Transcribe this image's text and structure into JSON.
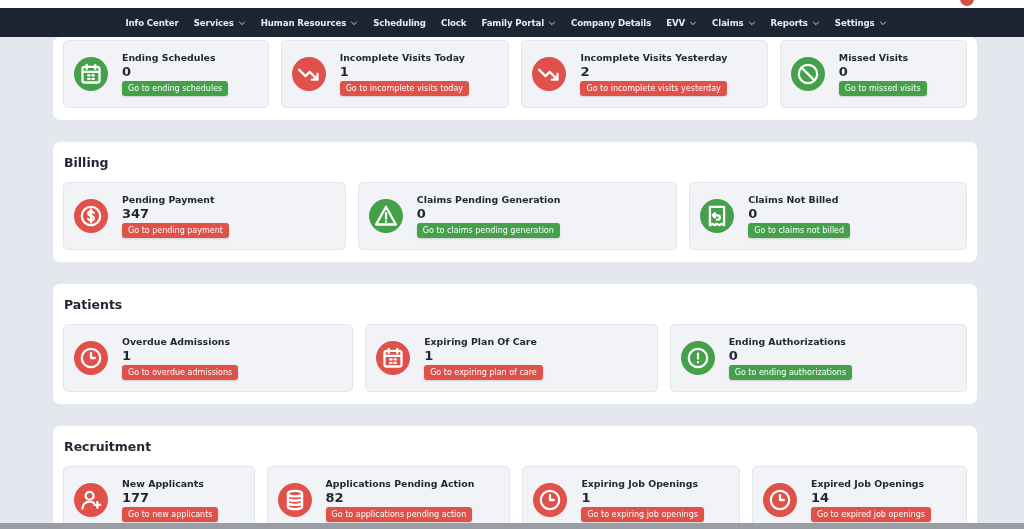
{
  "nav": {
    "items": [
      {
        "label": "Info Center",
        "has_menu": false
      },
      {
        "label": "Services",
        "has_menu": true
      },
      {
        "label": "Human Resources",
        "has_menu": true
      },
      {
        "label": "Scheduling",
        "has_menu": false
      },
      {
        "label": "Clock",
        "has_menu": false
      },
      {
        "label": "Family Portal",
        "has_menu": true
      },
      {
        "label": "Company Details",
        "has_menu": false
      },
      {
        "label": "EVV",
        "has_menu": true
      },
      {
        "label": "Claims",
        "has_menu": true
      },
      {
        "label": "Reports",
        "has_menu": true
      },
      {
        "label": "Settings",
        "has_menu": true
      }
    ]
  },
  "sections": [
    {
      "cards": [
        {
          "title": "Ending Schedules",
          "count": "0",
          "link": "Go to ending schedules",
          "color": "#44a14a"
        },
        {
          "title": "Incomplete Visits Today",
          "count": "1",
          "link": "Go to incomplete visits today",
          "color": "#e0514a"
        },
        {
          "title": "Incomplete Visits Yesterday",
          "count": "2",
          "link": "Go to incomplete visits yesterday",
          "color": "#e0514a"
        },
        {
          "title": "Missed Visits",
          "count": "0",
          "link": "Go to missed visits",
          "color": "#44a14a"
        }
      ]
    },
    {
      "title": "Billing",
      "cards": [
        {
          "title": "Pending Payment",
          "count": "347",
          "link": "Go to pending payment",
          "color": "#e0514a"
        },
        {
          "title": "Claims Pending Generation",
          "count": "0",
          "link": "Go to claims pending generation",
          "color": "#44a14a"
        },
        {
          "title": "Claims Not Billed",
          "count": "0",
          "link": "Go to claims not billed",
          "color": "#44a14a"
        }
      ]
    },
    {
      "title": "Patients",
      "cards": [
        {
          "title": "Overdue Admissions",
          "count": "1",
          "link": "Go to overdue admissions",
          "color": "#e0514a"
        },
        {
          "title": "Expiring Plan Of Care",
          "count": "1",
          "link": "Go to expiring plan of care",
          "color": "#e0514a"
        },
        {
          "title": "Ending Authorizations",
          "count": "0",
          "link": "Go to ending authorizations",
          "color": "#44a14a"
        }
      ]
    },
    {
      "title": "Recruitment",
      "cards": [
        {
          "title": "New Applicants",
          "count": "177",
          "link": "Go to new applicants",
          "color": "#e0514a"
        },
        {
          "title": "Applications Pending Action",
          "count": "82",
          "link": "Go to applications pending action",
          "color": "#e0514a"
        },
        {
          "title": "Expiring Job Openings",
          "count": "1",
          "link": "Go to expiring job openings",
          "color": "#e0514a"
        },
        {
          "title": "Expired Job Openings",
          "count": "14",
          "link": "Go to expired job openings",
          "color": "#e0514a"
        }
      ]
    }
  ]
}
